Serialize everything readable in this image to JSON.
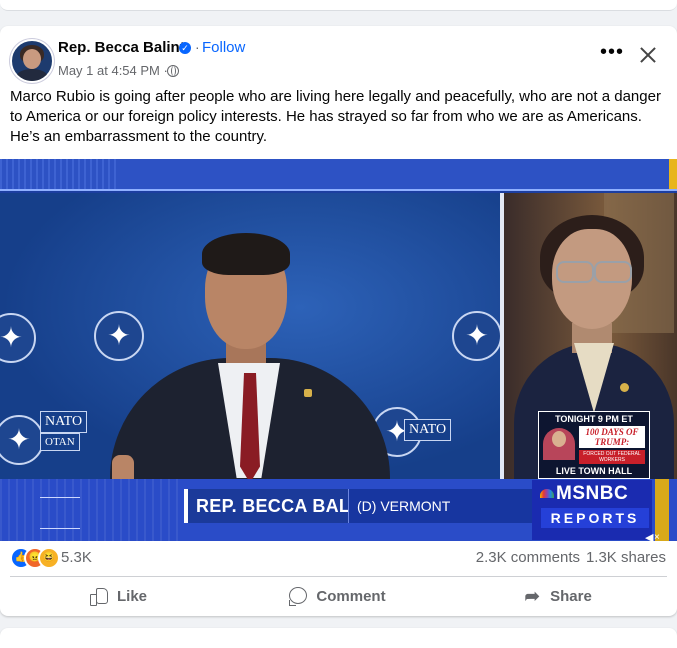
{
  "post": {
    "author": "Rep. Becca Balint",
    "verified_icon": "verified-badge-icon",
    "separator": "·",
    "follow_label": "Follow",
    "timestamp": "May 1 at 4:54 PM ·",
    "audience_icon": "globe-icon",
    "text": "Marco Rubio is going after people who are living here legally and peacefully, who are not a danger to America or our foreign policy interests. He has strayed so far from who we are as Americans. He’s an embarrassment to the country.",
    "more_label": "•••"
  },
  "video": {
    "nato_labels": [
      "NATO",
      "NATO",
      "OTAN"
    ],
    "promo_top": "TONIGHT 9 PM ET",
    "promo_headline": "100 DAYS OF TRUMP:",
    "promo_sub": "FORCED OUT FEDERAL WORKERS",
    "promo_bottom": "LIVE TOWN HALL",
    "chyron_name": "REP. BECCA BALINT",
    "chyron_party": "(D) VERMONT",
    "network": "MSNBC",
    "show": "REPORTS",
    "mini_close": "×",
    "colors": {
      "chyron_blue": "#1b3a9a",
      "accent_gold": "#d8a91a"
    }
  },
  "engagement": {
    "reactions": [
      "like",
      "angry",
      "haha"
    ],
    "reaction_count": "5.3K",
    "comments": "2.3K comments",
    "shares": "1.3K shares"
  },
  "actions": {
    "like": "Like",
    "comment": "Comment",
    "share": "Share"
  }
}
